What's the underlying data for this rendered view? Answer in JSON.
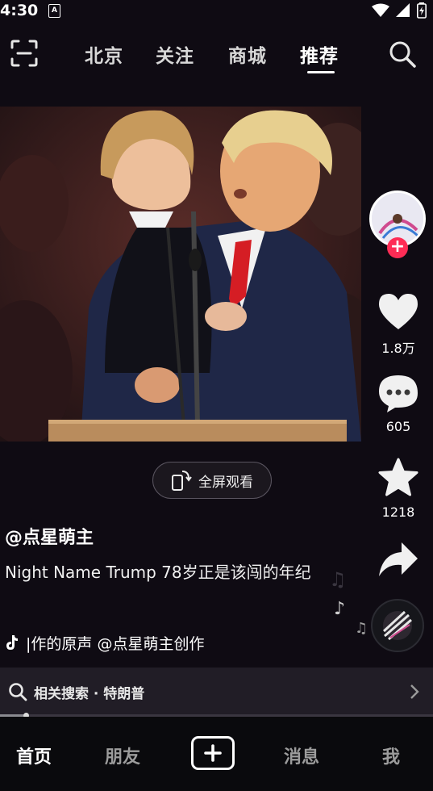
{
  "status": {
    "time": "4:30",
    "app_badge": "A"
  },
  "top_nav": {
    "tabs": [
      {
        "label": "北京"
      },
      {
        "label": "关注"
      },
      {
        "label": "商城"
      },
      {
        "label": "推荐",
        "active": true
      }
    ]
  },
  "rail": {
    "likes": "1.8万",
    "comments": "605",
    "favorites": "1218"
  },
  "fullscreen_label": "全屏观看",
  "caption": {
    "author": "@点星萌主",
    "description": "Night Name Trump 78岁正是该闯的年纪",
    "music": "|作的原声    @点星萌主创作"
  },
  "related_search": "相关搜索 · 特朗普",
  "progress": {
    "fraction": 0.06
  },
  "bottom_nav": {
    "home": "首页",
    "friends": "朋友",
    "messages": "消息",
    "me": "我"
  },
  "colors": {
    "accent": "#fe2c55",
    "background": "#0f0b13",
    "suit": "#1f2747",
    "tie": "#d51d24"
  },
  "icons": [
    "scan-icon",
    "search-icon",
    "heart-icon",
    "comment-icon",
    "star-icon",
    "share-icon",
    "music-note-icon",
    "tiktok-icon",
    "plus-icon",
    "chevron-right-icon",
    "wifi-icon",
    "battery-icon",
    "signal-icon"
  ]
}
